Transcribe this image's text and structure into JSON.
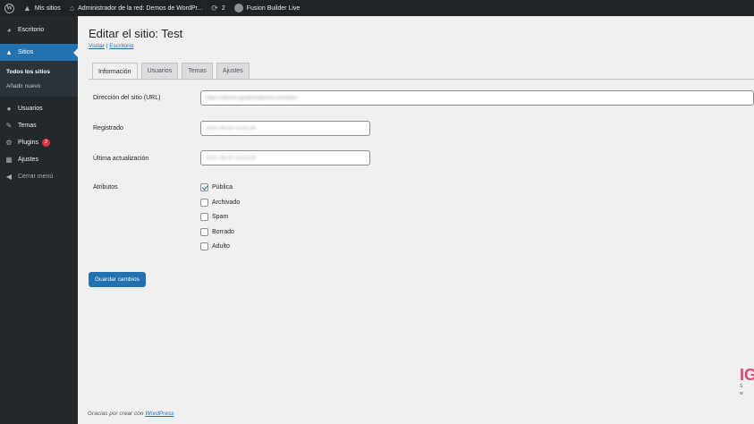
{
  "adminbar": {
    "mysites_label": "Mis sitios",
    "network_admin_label": "Administrador de la red: Demos de WordPr...",
    "updates_count": "2",
    "fusion_label": "Fusion Builder Live"
  },
  "sidebar": {
    "items": [
      {
        "label": "Escritorio",
        "icon": "dashboard-icon"
      },
      {
        "label": "Sitios",
        "icon": "sites-icon"
      },
      {
        "label": "Usuarios",
        "icon": "users-icon"
      },
      {
        "label": "Temas",
        "icon": "themes-icon"
      },
      {
        "label": "Plugins",
        "icon": "plugins-icon",
        "badge": "2"
      },
      {
        "label": "Ajustes",
        "icon": "settings-icon"
      },
      {
        "label": "Cerrar menú",
        "icon": "collapse-icon"
      }
    ],
    "submenu": [
      "Todos los sitios",
      "Añadir nuevo"
    ]
  },
  "page": {
    "title": "Editar el sitio: Test",
    "link_visit": "Visitar",
    "link_separator": "|",
    "link_dashboard": "Escritorio",
    "tabs": [
      "Información",
      "Usuarios",
      "Temas",
      "Ajustes"
    ],
    "active_tab": "Información"
  },
  "form": {
    "url_label": "Dirección del sitio (URL)",
    "url_value": "https://demos.guiawordpress.com/test/",
    "registered_label": "Registrado",
    "registered_value": "2021-06-30 14:53:28",
    "updated_label": "Última actualización",
    "updated_value": "2021-06-30 15:53:28",
    "attributes_label": "Atributos",
    "attributes": [
      {
        "label": "Pública",
        "checked": true
      },
      {
        "label": "Archivado",
        "checked": false
      },
      {
        "label": "Spam",
        "checked": false
      },
      {
        "label": "Borrado",
        "checked": false
      },
      {
        "label": "Adulto",
        "checked": false
      }
    ],
    "save_label": "Guardar cambios"
  },
  "footer": {
    "text": "Gracias por crear con",
    "link": "WordPress"
  },
  "colors": {
    "accent": "#2271b1",
    "adminbar": "#1d2327",
    "sidebar": "#23282d",
    "badge": "#d63638",
    "background": "#f0f0f1"
  }
}
